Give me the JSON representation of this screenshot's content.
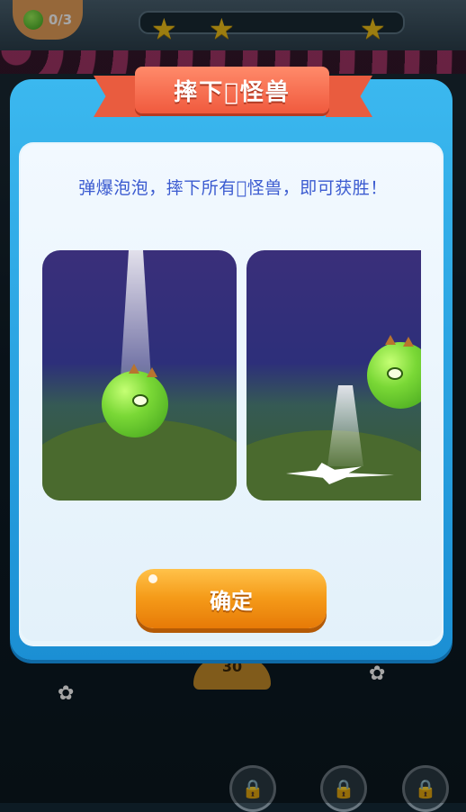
{
  "hud": {
    "counter_text": "0/3",
    "progress_stars": 3,
    "cannon_number": "30"
  },
  "dialog": {
    "title": "摔下\u0000怪兽",
    "instruction": "弹爆泡泡，摔下所有\u0000怪兽，即可获胜！",
    "confirm_label": "确定"
  },
  "colors": {
    "modal_blue": "#1b8fd4",
    "ribbon_red": "#f05a3e",
    "button_orange": "#f59b19",
    "instruction_text": "#3b5bd0",
    "star_yellow": "#f0c11a"
  },
  "icons": {
    "counter_icon": "green-monster-icon",
    "star": "star-icon",
    "lock": "lock-icon"
  }
}
